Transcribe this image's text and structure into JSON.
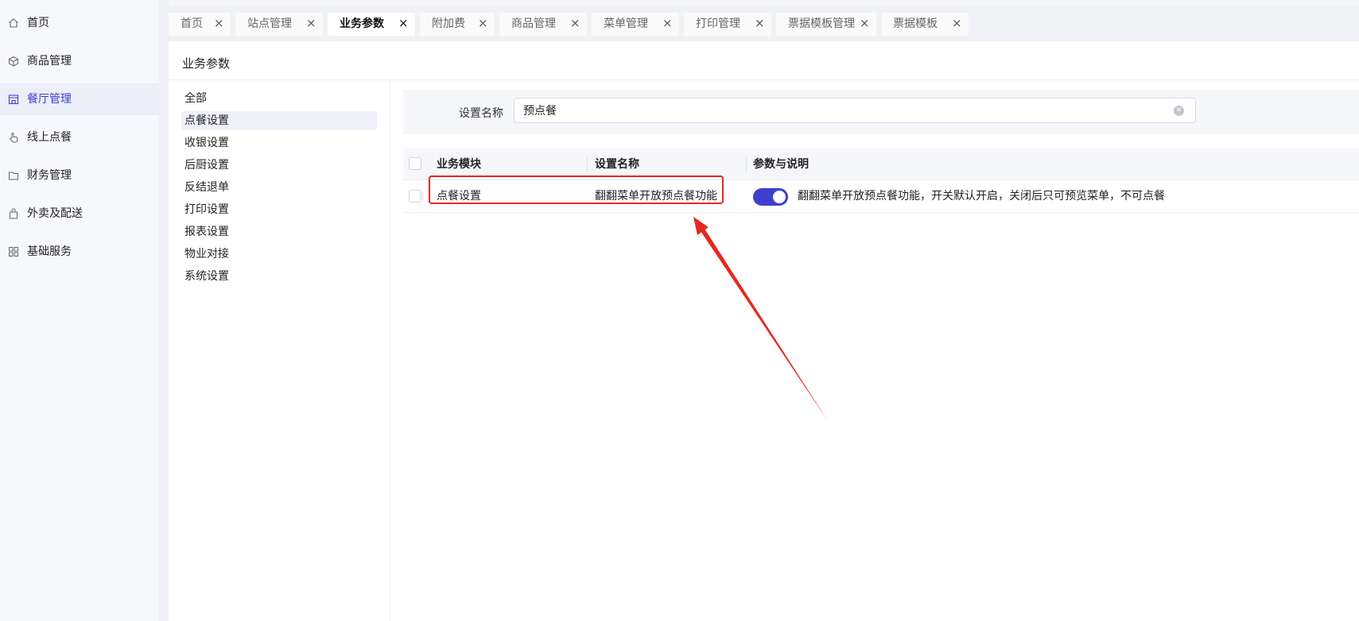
{
  "sidebar": {
    "items": [
      {
        "label": "首页",
        "icon": "home-icon"
      },
      {
        "label": "商品管理",
        "icon": "cube-icon"
      },
      {
        "label": "餐厅管理",
        "icon": "store-icon",
        "active": true
      },
      {
        "label": "线上点餐",
        "icon": "hand-pointer-icon"
      },
      {
        "label": "财务管理",
        "icon": "wallet-icon"
      },
      {
        "label": "外卖及配送",
        "icon": "bag-icon"
      },
      {
        "label": "基础服务",
        "icon": "grid-icon"
      }
    ]
  },
  "tabs": [
    {
      "label": "首页"
    },
    {
      "label": "站点管理"
    },
    {
      "label": "业务参数",
      "active": true
    },
    {
      "label": "附加费"
    },
    {
      "label": "商品管理"
    },
    {
      "label": "菜单管理"
    },
    {
      "label": "打印管理"
    },
    {
      "label": "票据模板管理"
    },
    {
      "label": "票据模板"
    }
  ],
  "tab_close": "×",
  "page": {
    "title": "业务参数"
  },
  "categories": [
    "全部",
    "点餐设置",
    "收银设置",
    "后厨设置",
    "反结退单",
    "打印设置",
    "报表设置",
    "物业对接",
    "系统设置"
  ],
  "filter": {
    "label": "设置名称",
    "value": "预点餐"
  },
  "table": {
    "headers": {
      "module": "业务模块",
      "name": "设置名称",
      "desc": "参数与说明"
    },
    "rows": [
      {
        "module": "点餐设置",
        "name": "翻翻菜单开放预点餐功能",
        "enabled": true,
        "desc": "翻翻菜单开放预点餐功能，开关默认开启，关闭后只可预览菜单，不可点餐"
      }
    ]
  },
  "colors": {
    "accent": "#3d3fcf",
    "annotation": "#e5281f"
  }
}
